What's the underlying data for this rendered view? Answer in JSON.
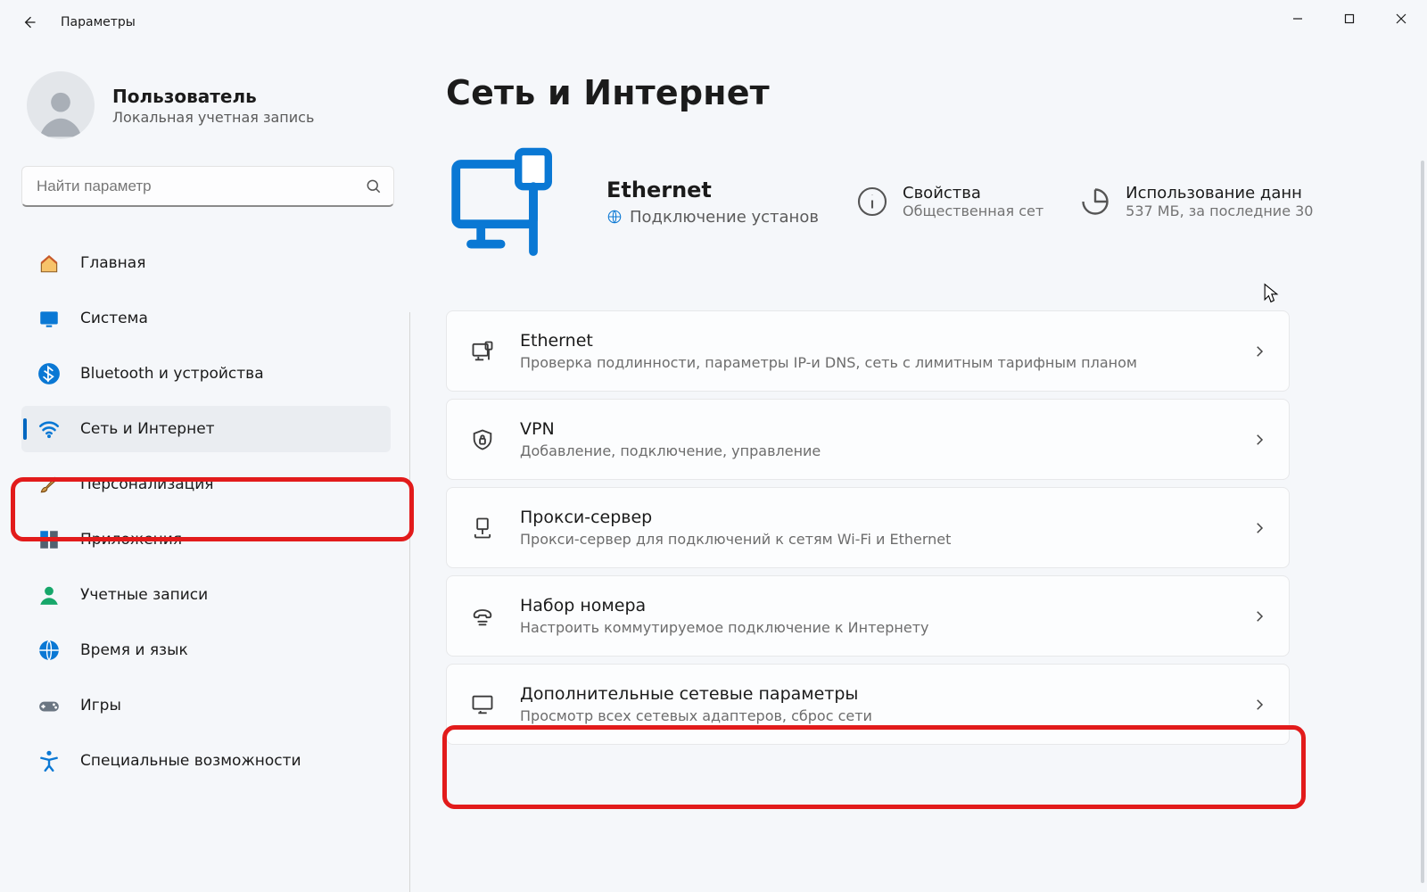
{
  "window": {
    "title": "Параметры",
    "controls": {
      "minimize": "minimize-icon",
      "maximize": "maximize-icon",
      "close": "close-icon"
    }
  },
  "user": {
    "name": "Пользователь",
    "subtitle": "Локальная учетная запись"
  },
  "search": {
    "placeholder": "Найти параметр"
  },
  "sidebar": {
    "items": [
      {
        "id": "home",
        "label": "Главная",
        "icon": "home-icon",
        "active": false
      },
      {
        "id": "system",
        "label": "Система",
        "icon": "system-icon",
        "active": false
      },
      {
        "id": "bluetooth",
        "label": "Bluetooth и устройства",
        "icon": "bluetooth-icon",
        "active": false
      },
      {
        "id": "network",
        "label": "Сеть и Интернет",
        "icon": "wifi-icon",
        "active": true
      },
      {
        "id": "personalize",
        "label": "Персонализация",
        "icon": "brush-icon",
        "active": false
      },
      {
        "id": "apps",
        "label": "Приложения",
        "icon": "apps-icon",
        "active": false
      },
      {
        "id": "accounts",
        "label": "Учетные записи",
        "icon": "person-icon",
        "active": false
      },
      {
        "id": "time",
        "label": "Время и язык",
        "icon": "globe-clock-icon",
        "active": false
      },
      {
        "id": "games",
        "label": "Игры",
        "icon": "gamepad-icon",
        "active": false
      },
      {
        "id": "accessibility",
        "label": "Специальные возможности",
        "icon": "accessibility-icon",
        "active": false
      }
    ]
  },
  "main": {
    "title": "Сеть и Интернет",
    "status": {
      "name": "Ethernet",
      "state": "Подключение установ",
      "props_label": "Свойства",
      "props_sub": "Общественная сет",
      "usage_label": "Использование данн",
      "usage_sub": "537 МБ, за последние 30"
    },
    "cards": [
      {
        "id": "ethernet",
        "title": "Ethernet",
        "sub": "Проверка подлинности, параметры IP-и DNS, сеть с лимитным тарифным планом",
        "icon": "ethernet-icon"
      },
      {
        "id": "vpn",
        "title": "VPN",
        "sub": "Добавление, подключение, управление",
        "icon": "shield-lock-icon"
      },
      {
        "id": "proxy",
        "title": "Прокси-сервер",
        "sub": "Прокси-сервер для подключений к сетям Wi-Fi и Ethernet",
        "icon": "proxy-icon"
      },
      {
        "id": "dialup",
        "title": "Набор номера",
        "sub": "Настроить коммутируемое подключение к Интернету",
        "icon": "phone-icon"
      },
      {
        "id": "advanced",
        "title": "Дополнительные сетевые параметры",
        "sub": "Просмотр всех сетевых адаптеров, сброс сети",
        "icon": "monitor-icon",
        "highlighted": true
      }
    ]
  },
  "colors": {
    "accent": "#0067c0",
    "highlight": "#e21b1b"
  }
}
